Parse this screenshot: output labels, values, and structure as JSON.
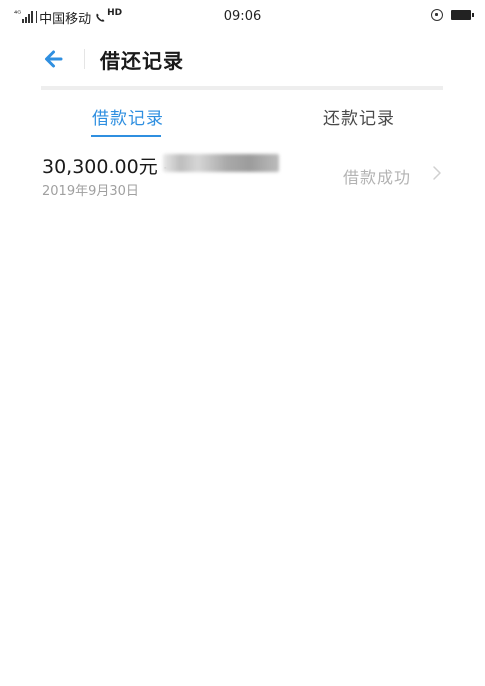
{
  "status_bar": {
    "network_prefix": "⁴ᴳ",
    "carrier": "中国移动",
    "hd_label": "HD",
    "time": "09:06"
  },
  "header": {
    "title": "借还记录"
  },
  "tabs": [
    {
      "label": "借款记录",
      "active": true
    },
    {
      "label": "还款记录",
      "active": false
    }
  ],
  "records": [
    {
      "amount": "30,300.00元 -",
      "date": "2019年9月30日",
      "status": "借款成功"
    }
  ],
  "colors": {
    "accent": "#2f8fe0",
    "status_text": "#b3b3b3",
    "date_text": "#a0a0a0"
  }
}
